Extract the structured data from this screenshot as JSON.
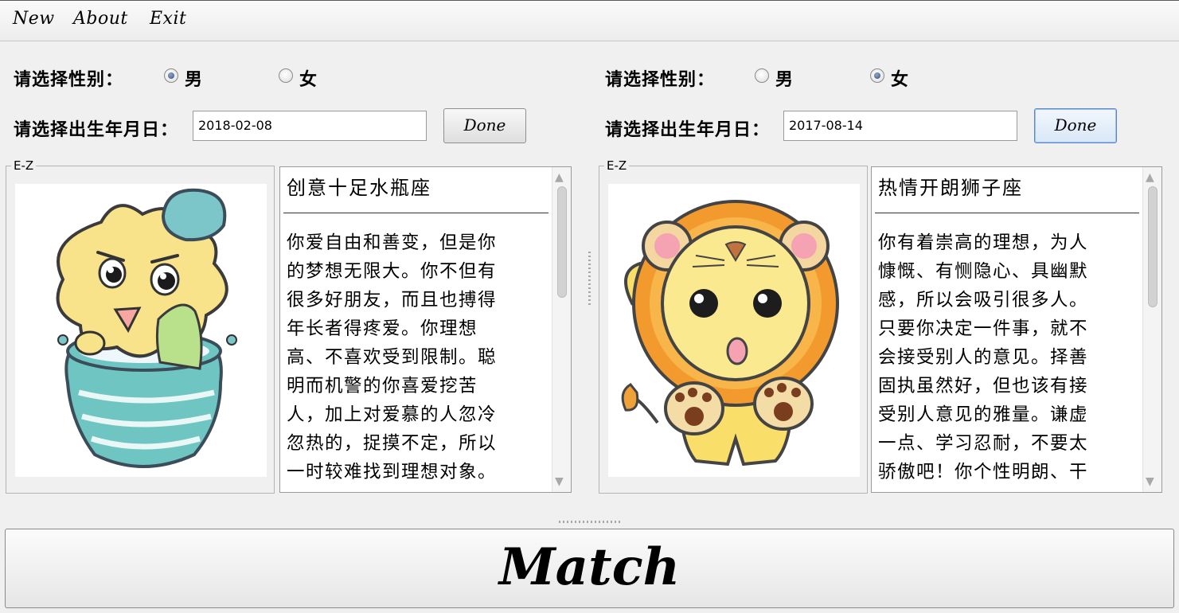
{
  "menu": [
    "New",
    "About",
    "Exit"
  ],
  "left": {
    "gender_label": "请选择性别：",
    "gender_options": [
      {
        "label": "男",
        "checked": true
      },
      {
        "label": "女",
        "checked": false
      }
    ],
    "birth_label": "请选择出生年月日：",
    "birth_value": "2018-02-08",
    "done_label": "Done",
    "group_title": "E-Z",
    "sign_title": "创意十足水瓶座",
    "sign_text": "你爱自由和善变，但是你\n的梦想无限大。你不但有\n很多好朋友，而且也搏得\n年长者得疼爱。你理想\n高、不喜欢受到限制。聪\n明而机警的你喜爱挖苦\n人，加上对爱慕的人忽冷\n忽热的，捉摸不定，所以\n一时较难找到理想对象。"
  },
  "right": {
    "gender_label": "请选择性别：",
    "gender_options": [
      {
        "label": "男",
        "checked": false
      },
      {
        "label": "女",
        "checked": true
      }
    ],
    "birth_label": "请选择出生年月日：",
    "birth_value": "2017-08-14",
    "done_label": "Done",
    "group_title": "E-Z",
    "sign_title": "热情开朗狮子座",
    "sign_text": "你有着崇高的理想，为人\n慷慨、有恻隐心、具幽默\n感，所以会吸引很多人。\n只要你决定一件事，就不\n会接受别人的意见。择善\n固执虽然好，但也该有接\n受别人意见的雅量。谦虚\n一点、学习忍耐，不要太\n骄傲吧！你个性明朗、干"
  },
  "match_label": "Match"
}
